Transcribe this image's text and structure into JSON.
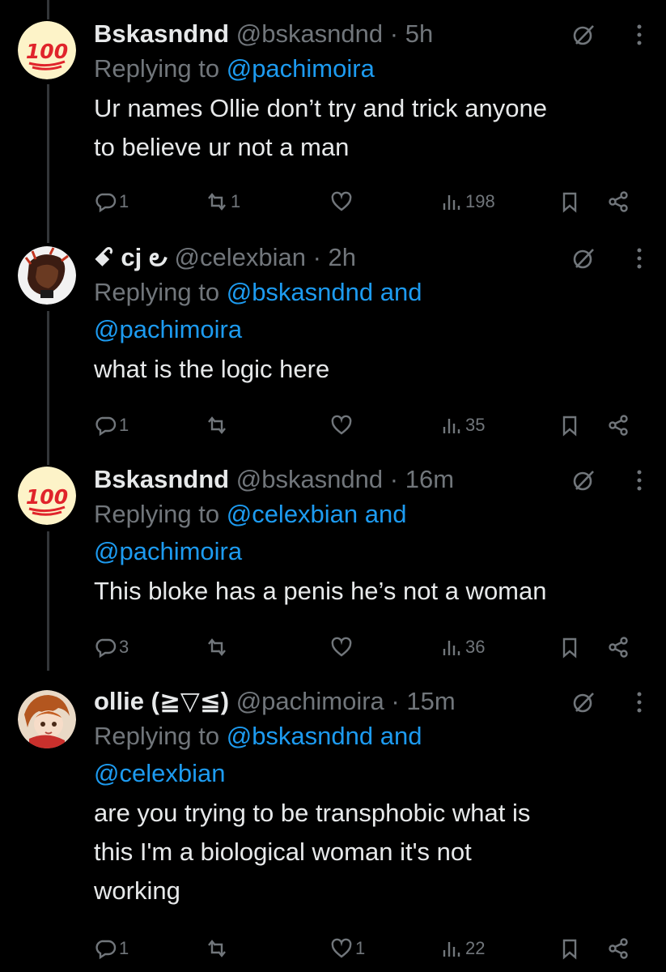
{
  "tweets": [
    {
      "name": "Bskasndnd",
      "handle": "@bskasndnd",
      "time": "· 5h",
      "reply_prefix": "Replying to ",
      "mentions_line1": "@pachimoira",
      "mentions_line2": "",
      "text": [
        "Ur names Ollie don’t try and trick anyone",
        "to believe ur not a man"
      ],
      "replies": "1",
      "reposts": "1",
      "likes": "",
      "views": "198",
      "avatar": "100-emoji-icon"
    },
    {
      "name": "ꗃ cj ౿",
      "handle": "@celexbian",
      "time": "· 2h",
      "reply_prefix": "Replying to ",
      "mentions_line1": "@bskasndnd and",
      "mentions_line2": "@pachimoira",
      "text": [
        "what is the logic here"
      ],
      "replies": "1",
      "reposts": "",
      "likes": "",
      "views": "35",
      "avatar": "drawn-character-avatar"
    },
    {
      "name": "Bskasndnd",
      "handle": "@bskasndnd",
      "time": "· 16m",
      "reply_prefix": "Replying to ",
      "mentions_line1": "@celexbian and",
      "mentions_line2": "@pachimoira",
      "text": [
        "This bloke has a penis he’s not a woman"
      ],
      "replies": "3",
      "reposts": "",
      "likes": "",
      "views": "36",
      "avatar": "100-emoji-icon"
    },
    {
      "name": "ollie (≧▽≦)",
      "handle": "@pachimoira",
      "time": "· 15m",
      "reply_prefix": "Replying to ",
      "mentions_line1": "@bskasndnd and",
      "mentions_line2": "@celexbian",
      "text": [
        "are you trying to be transphobic what is",
        "this I'm a biological woman it's not",
        "working"
      ],
      "replies": "1",
      "reposts": "",
      "likes": "1",
      "views": "22",
      "avatar": "anime-character-avatar"
    }
  ],
  "colors": {
    "background": "#000000",
    "text": "#e7e9ea",
    "muted": "#71767b",
    "link": "#1d9bf0"
  }
}
